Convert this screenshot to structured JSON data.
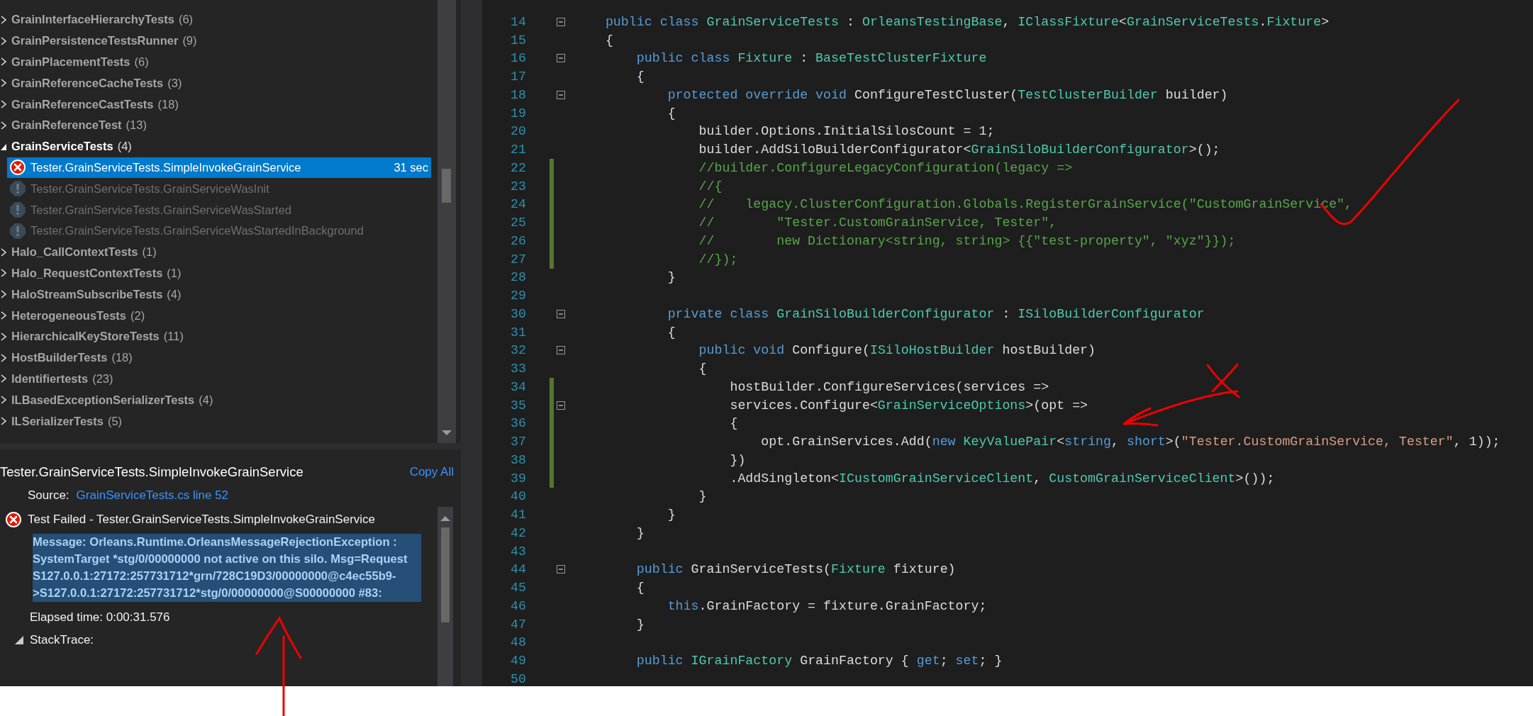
{
  "test_explorer": {
    "groups": [
      {
        "label": "GrainInterfaceHierarchyTests",
        "count": "(6)",
        "expanded": false
      },
      {
        "label": "GrainPersistenceTestsRunner",
        "count": "(9)",
        "expanded": false
      },
      {
        "label": "GrainPlacementTests",
        "count": "(6)",
        "expanded": false
      },
      {
        "label": "GrainReferenceCacheTests",
        "count": "(3)",
        "expanded": false
      },
      {
        "label": "GrainReferenceCastTests",
        "count": "(18)",
        "expanded": false
      },
      {
        "label": "GrainReferenceTest",
        "count": "(13)",
        "expanded": false
      },
      {
        "label": "GrainServiceTests",
        "count": "(4)",
        "expanded": true,
        "children": [
          {
            "label": "Tester.GrainServiceTests.SimpleInvokeGrainService",
            "failed": true,
            "selected": true,
            "duration": "31 sec"
          },
          {
            "label": "Tester.GrainServiceTests.GrainServiceWasInit",
            "failed": false,
            "selected": false
          },
          {
            "label": "Tester.GrainServiceTests.GrainServiceWasStarted",
            "failed": false,
            "selected": false
          },
          {
            "label": "Tester.GrainServiceTests.GrainServiceWasStartedInBackground",
            "failed": false,
            "selected": false
          }
        ]
      },
      {
        "label": "Halo_CallContextTests",
        "count": "(1)",
        "expanded": false
      },
      {
        "label": "Halo_RequestContextTests",
        "count": "(1)",
        "expanded": false
      },
      {
        "label": "HaloStreamSubscribeTests",
        "count": "(4)",
        "expanded": false
      },
      {
        "label": "HeterogeneousTests",
        "count": "(2)",
        "expanded": false
      },
      {
        "label": "HierarchicalKeyStoreTests",
        "count": "(11)",
        "expanded": false
      },
      {
        "label": "HostBuilderTests",
        "count": "(18)",
        "expanded": false
      },
      {
        "label": "Identifiertests",
        "count": "(23)",
        "expanded": false
      },
      {
        "label": "ILBasedExceptionSerializerTests",
        "count": "(4)",
        "expanded": false
      },
      {
        "label": "ILSerializerTests",
        "count": "(5)",
        "expanded": false
      }
    ]
  },
  "test_details": {
    "title": "Tester.GrainServiceTests.SimpleInvokeGrainService",
    "copy_all": "Copy All",
    "source_label": "Source:",
    "source_link": "GrainServiceTests.cs line 52",
    "failed": true,
    "result": "Test Failed - Tester.GrainServiceTests.SimpleInvokeGrainService",
    "message": "Message: Orleans.Runtime.OrleansMessageRejectionException : SystemTarget *stg/0/00000000 not active on this silo. Msg=Request S127.0.0.1:27172:257731712*grn/728C19D3/00000000@c4ec55b9->S127.0.0.1:27172:257731712*stg/0/00000000@S00000000 #83:",
    "message_selected": true,
    "elapsed": "Elapsed time: 0:00:31.576",
    "stacktrace_label": "StackTrace:",
    "stacktrace_expanded": true
  },
  "editor": {
    "lines": [
      {
        "number": "14",
        "fold": true,
        "changed": false,
        "tokens": [
          {
            "kind": "keyword",
            "text": "    public class "
          },
          {
            "kind": "type",
            "text": "GrainServiceTests"
          },
          {
            "kind": "plain",
            "text": " : "
          },
          {
            "kind": "type",
            "text": "OrleansTestingBase"
          },
          {
            "kind": "plain",
            "text": ", "
          },
          {
            "kind": "type",
            "text": "IClassFixture"
          },
          {
            "kind": "plain",
            "text": "<"
          },
          {
            "kind": "type",
            "text": "GrainServiceTests"
          },
          {
            "kind": "plain",
            "text": "."
          },
          {
            "kind": "type",
            "text": "Fixture"
          },
          {
            "kind": "plain",
            "text": ">"
          }
        ]
      },
      {
        "number": "15",
        "fold": false,
        "changed": false,
        "tokens": [
          {
            "kind": "plain",
            "text": "    {"
          }
        ]
      },
      {
        "number": "16",
        "fold": true,
        "changed": false,
        "tokens": [
          {
            "kind": "keyword",
            "text": "        public class "
          },
          {
            "kind": "type",
            "text": "Fixture"
          },
          {
            "kind": "plain",
            "text": " : "
          },
          {
            "kind": "type",
            "text": "BaseTestClusterFixture"
          }
        ]
      },
      {
        "number": "17",
        "fold": false,
        "changed": false,
        "tokens": [
          {
            "kind": "plain",
            "text": "        {"
          }
        ]
      },
      {
        "number": "18",
        "fold": true,
        "changed": false,
        "tokens": [
          {
            "kind": "keyword",
            "text": "            protected override void "
          },
          {
            "kind": "plain",
            "text": "ConfigureTestCluster("
          },
          {
            "kind": "type",
            "text": "TestClusterBuilder"
          },
          {
            "kind": "plain",
            "text": " builder)"
          }
        ]
      },
      {
        "number": "19",
        "fold": false,
        "changed": false,
        "tokens": [
          {
            "kind": "plain",
            "text": "            {"
          }
        ]
      },
      {
        "number": "20",
        "fold": false,
        "changed": false,
        "tokens": [
          {
            "kind": "plain",
            "text": "                builder.Options.InitialSilosCount = 1;"
          }
        ]
      },
      {
        "number": "21",
        "fold": false,
        "changed": false,
        "tokens": [
          {
            "kind": "plain",
            "text": "                builder.AddSiloBuilderConfigurator<"
          },
          {
            "kind": "type",
            "text": "GrainSiloBuilderConfigurator"
          },
          {
            "kind": "plain",
            "text": ">();"
          }
        ]
      },
      {
        "number": "22",
        "fold": false,
        "changed": true,
        "tokens": [
          {
            "kind": "comment",
            "text": "                //builder.ConfigureLegacyConfiguration(legacy =>"
          }
        ]
      },
      {
        "number": "23",
        "fold": false,
        "changed": true,
        "tokens": [
          {
            "kind": "comment",
            "text": "                //{"
          }
        ]
      },
      {
        "number": "24",
        "fold": false,
        "changed": true,
        "tokens": [
          {
            "kind": "comment",
            "text": "                //    legacy.ClusterConfiguration.Globals.RegisterGrainService(\"CustomGrainService\","
          }
        ]
      },
      {
        "number": "25",
        "fold": false,
        "changed": true,
        "tokens": [
          {
            "kind": "comment",
            "text": "                //        \"Tester.CustomGrainService, Tester\","
          }
        ]
      },
      {
        "number": "26",
        "fold": false,
        "changed": true,
        "tokens": [
          {
            "kind": "comment",
            "text": "                //        new Dictionary<string, string> {{\"test-property\", \"xyz\"}});"
          }
        ]
      },
      {
        "number": "27",
        "fold": false,
        "changed": true,
        "tokens": [
          {
            "kind": "comment",
            "text": "                //});"
          }
        ]
      },
      {
        "number": "28",
        "fold": false,
        "changed": false,
        "tokens": [
          {
            "kind": "plain",
            "text": "            }"
          }
        ]
      },
      {
        "number": "29",
        "fold": false,
        "changed": false
      },
      {
        "number": "30",
        "fold": true,
        "changed": false,
        "tokens": [
          {
            "kind": "keyword",
            "text": "            private class "
          },
          {
            "kind": "type",
            "text": "GrainSiloBuilderConfigurator"
          },
          {
            "kind": "plain",
            "text": " : "
          },
          {
            "kind": "type",
            "text": "ISiloBuilderConfigurator"
          }
        ]
      },
      {
        "number": "31",
        "fold": false,
        "changed": false,
        "tokens": [
          {
            "kind": "plain",
            "text": "            {"
          }
        ]
      },
      {
        "number": "32",
        "fold": true,
        "changed": false,
        "tokens": [
          {
            "kind": "keyword",
            "text": "                public void "
          },
          {
            "kind": "plain",
            "text": "Configure("
          },
          {
            "kind": "type",
            "text": "ISiloHostBuilder"
          },
          {
            "kind": "plain",
            "text": " hostBuilder)"
          }
        ]
      },
      {
        "number": "33",
        "fold": false,
        "changed": false,
        "tokens": [
          {
            "kind": "plain",
            "text": "                {"
          }
        ]
      },
      {
        "number": "34",
        "fold": false,
        "changed": true,
        "tokens": [
          {
            "kind": "plain",
            "text": "                    hostBuilder.ConfigureServices(services =>"
          }
        ]
      },
      {
        "number": "35",
        "fold": true,
        "changed": true,
        "tokens": [
          {
            "kind": "plain",
            "text": "                    services.Configure<"
          },
          {
            "kind": "type",
            "text": "GrainServiceOptions"
          },
          {
            "kind": "plain",
            "text": ">(opt =>"
          }
        ]
      },
      {
        "number": "36",
        "fold": false,
        "changed": true,
        "tokens": [
          {
            "kind": "plain",
            "text": "                    {"
          }
        ]
      },
      {
        "number": "37",
        "fold": false,
        "changed": true,
        "tokens": [
          {
            "kind": "plain",
            "text": "                        opt.GrainServices.Add("
          },
          {
            "kind": "keyword",
            "text": "new "
          },
          {
            "kind": "type",
            "text": "KeyValuePair"
          },
          {
            "kind": "plain",
            "text": "<"
          },
          {
            "kind": "keyword",
            "text": "string"
          },
          {
            "kind": "plain",
            "text": ", "
          },
          {
            "kind": "keyword",
            "text": "short"
          },
          {
            "kind": "plain",
            "text": ">("
          },
          {
            "kind": "string",
            "text": "\"Tester.CustomGrainService, Tester\""
          },
          {
            "kind": "plain",
            "text": ", 1));"
          }
        ]
      },
      {
        "number": "38",
        "fold": false,
        "changed": true,
        "tokens": [
          {
            "kind": "plain",
            "text": "                    })"
          }
        ]
      },
      {
        "number": "39",
        "fold": false,
        "changed": true,
        "tokens": [
          {
            "kind": "plain",
            "text": "                    .AddSingleton<"
          },
          {
            "kind": "type",
            "text": "ICustomGrainServiceClient"
          },
          {
            "kind": "plain",
            "text": ", "
          },
          {
            "kind": "type",
            "text": "CustomGrainServiceClient"
          },
          {
            "kind": "plain",
            "text": ">());"
          }
        ]
      },
      {
        "number": "40",
        "fold": false,
        "changed": false,
        "tokens": [
          {
            "kind": "plain",
            "text": "                }"
          }
        ]
      },
      {
        "number": "41",
        "fold": false,
        "changed": false,
        "tokens": [
          {
            "kind": "plain",
            "text": "            }"
          }
        ]
      },
      {
        "number": "42",
        "fold": false,
        "changed": false,
        "tokens": [
          {
            "kind": "plain",
            "text": "        }"
          }
        ]
      },
      {
        "number": "43",
        "fold": false,
        "changed": false
      },
      {
        "number": "44",
        "fold": true,
        "changed": false,
        "tokens": [
          {
            "kind": "keyword",
            "text": "        public "
          },
          {
            "kind": "plain",
            "text": "GrainServiceTests("
          },
          {
            "kind": "type",
            "text": "Fixture"
          },
          {
            "kind": "plain",
            "text": " fixture)"
          }
        ]
      },
      {
        "number": "45",
        "fold": false,
        "changed": false,
        "tokens": [
          {
            "kind": "plain",
            "text": "        {"
          }
        ]
      },
      {
        "number": "46",
        "fold": false,
        "changed": false,
        "tokens": [
          {
            "kind": "keyword",
            "text": "            this"
          },
          {
            "kind": "plain",
            "text": ".GrainFactory = fixture.GrainFactory;"
          }
        ]
      },
      {
        "number": "47",
        "fold": false,
        "changed": false,
        "tokens": [
          {
            "kind": "plain",
            "text": "        }"
          }
        ]
      },
      {
        "number": "48",
        "fold": false,
        "changed": false
      },
      {
        "number": "49",
        "fold": false,
        "changed": false,
        "tokens": [
          {
            "kind": "keyword",
            "text": "        public "
          },
          {
            "kind": "type",
            "text": "IGrainFactory"
          },
          {
            "kind": "plain",
            "text": " GrainFactory { "
          },
          {
            "kind": "keyword",
            "text": "get"
          },
          {
            "kind": "plain",
            "text": "; "
          },
          {
            "kind": "keyword",
            "text": "set"
          },
          {
            "kind": "plain",
            "text": "; }"
          }
        ]
      },
      {
        "number": "50",
        "fold": false,
        "changed": false
      }
    ]
  }
}
